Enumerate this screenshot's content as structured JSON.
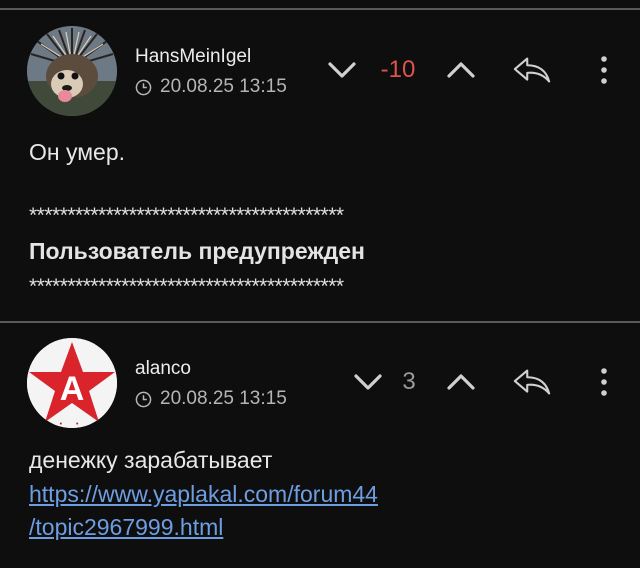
{
  "posts": [
    {
      "username": "HansMeinIgel",
      "timestamp": "20.08.25 13:15",
      "rating": "-10",
      "body_line1": "Он умер.",
      "stars_top": "*****************************************",
      "warning": "Пользователь предупрежден",
      "stars_bottom": "*****************************************",
      "avatar_icon": "hedgehog-avatar",
      "rating_color": "#e0524c"
    },
    {
      "username": "alanco",
      "timestamp": "20.08.25 13:15",
      "rating": "3",
      "body_line1": "денежку зарабатывает",
      "link_line1": "https://www.yaplakal.com/forum44",
      "link_line2": "/topic2967999.html",
      "avatar_icon": "red-star-avatar",
      "avatar_badge_text": "А",
      "rating_color": "#9a9a9a"
    }
  ],
  "colors": {
    "background": "#0e0e0e",
    "divider": "#5a5a5a",
    "link": "#6e9ee2",
    "negative": "#e0524c",
    "icon": "#d0d0d0"
  }
}
